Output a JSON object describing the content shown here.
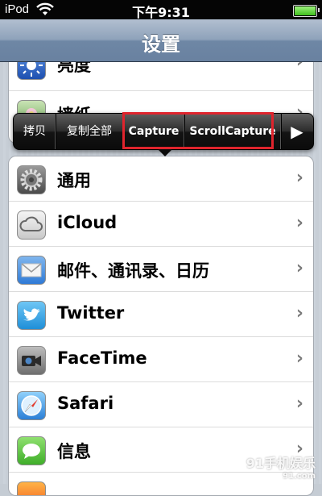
{
  "status_bar": {
    "carrier": "iPod",
    "time": "下午9:31"
  },
  "nav": {
    "title": "设置"
  },
  "top_rows": [
    {
      "label": "亮度"
    },
    {
      "label": "墙纸"
    }
  ],
  "edit_menu": {
    "items": [
      "拷贝",
      "复制全部",
      "Capture",
      "ScrollCapture"
    ],
    "next": "▶"
  },
  "rows": [
    {
      "label": "通用",
      "icon": "general-gear-icon"
    },
    {
      "label": "iCloud",
      "icon": "icloud-icon"
    },
    {
      "label": "邮件、通讯录、日历",
      "icon": "mail-icon"
    },
    {
      "label": "Twitter",
      "icon": "twitter-icon"
    },
    {
      "label": "FaceTime",
      "icon": "facetime-icon"
    },
    {
      "label": "Safari",
      "icon": "safari-icon"
    },
    {
      "label": "信息",
      "icon": "messages-icon"
    }
  ],
  "chevron": "›",
  "watermark": {
    "main": "91手机娱乐",
    "sub": "91.com"
  },
  "colors": {
    "highlight_box": "#e0242d",
    "nav_gradient_mid": "#8ea2ba"
  }
}
